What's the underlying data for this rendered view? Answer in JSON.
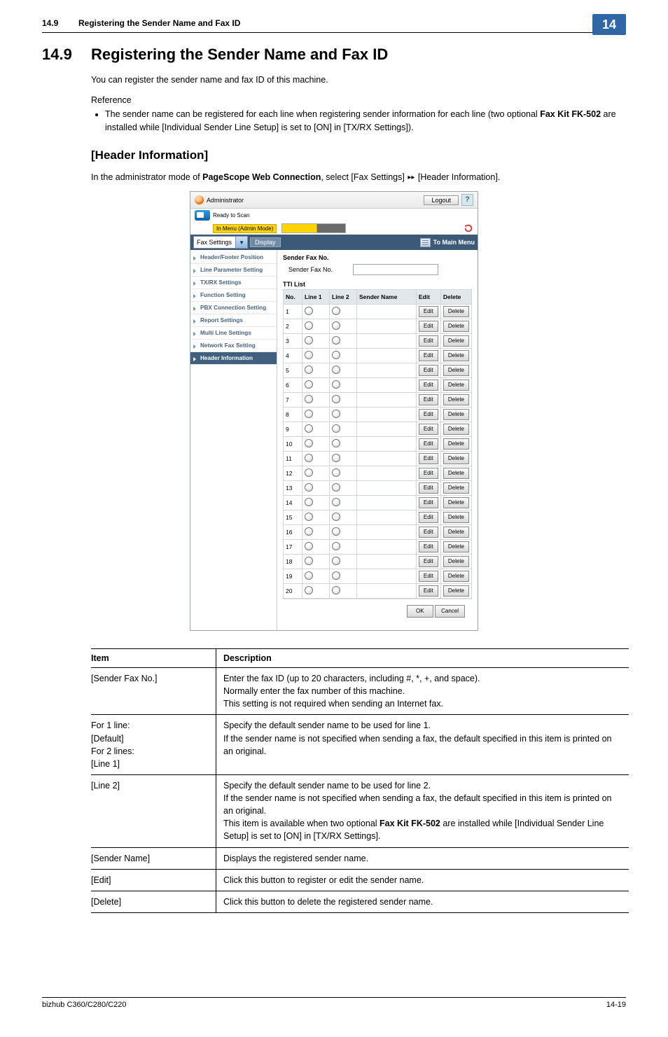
{
  "running_head": {
    "num": "14.9",
    "title": "Registering the Sender Name and Fax ID"
  },
  "chapter_tab": "14",
  "section": {
    "num": "14.9",
    "title": "Registering the Sender Name and Fax ID"
  },
  "intro": "You can register the sender name and fax ID of this machine.",
  "ref_label": "Reference",
  "ref_bullet_parts": {
    "a": "The sender name can be registered for each line when registering sender information for each line (two optional ",
    "b": "Fax Kit FK-502",
    "c": " are installed while [Individual Sender Line Setup] is set to [ON] in [TX/RX Settings])."
  },
  "sub_title": "[Header Information]",
  "sub_intro_parts": {
    "a": "In the administrator mode of ",
    "b": "PageScope Web Connection",
    "c": ", select [Fax Settings] ",
    "d": " [Header Information]."
  },
  "app": {
    "role": "Administrator",
    "logout": "Logout",
    "help": "?",
    "ready": "Ready to Scan",
    "menu_mode": "In Menu (Admin Mode)",
    "nav_select": "Fax Settings",
    "display_btn": "Display",
    "to_main_menu": "To Main Menu",
    "sidebar": [
      {
        "label": "Header/Footer Position",
        "active": false
      },
      {
        "label": "Line Parameter Setting",
        "active": false
      },
      {
        "label": "TX/RX Settings",
        "active": false
      },
      {
        "label": "Function Setting",
        "active": false
      },
      {
        "label": "PBX Connection Setting",
        "active": false
      },
      {
        "label": "Report Settings",
        "active": false
      },
      {
        "label": "Multi Line Settings",
        "active": false
      },
      {
        "label": "Network Fax Setting",
        "active": false
      },
      {
        "label": "Header Information",
        "active": true
      }
    ],
    "sender_fax_no_bold": "Sender Fax No.",
    "sender_fax_no_label": "Sender Fax No.",
    "tti_list_label": "TTI List",
    "tti_headers": {
      "no": "No.",
      "line1": "Line 1",
      "line2": "Line 2",
      "sender": "Sender Name",
      "edit": "Edit",
      "delete": "Delete"
    },
    "row_count": 20,
    "edit_btn": "Edit",
    "delete_btn": "Delete",
    "ok_btn": "OK",
    "cancel_btn": "Cancel"
  },
  "desc_table": {
    "head": {
      "item": "Item",
      "desc": "Description"
    },
    "rows": [
      {
        "item": "[Sender Fax No.]",
        "desc": "Enter the fax ID (up to 20 characters, including #, *, +, and space).\nNormally enter the fax number of this machine.\nThis setting is not required when sending an Internet fax."
      },
      {
        "item": "For 1 line:\n[Default]\nFor 2 lines:\n[Line 1]",
        "desc": "Specify the default sender name to be used for line 1.\nIf the sender name is not specified when sending a fax, the default specified in this item is printed on an original."
      },
      {
        "item": "[Line 2]",
        "desc_parts": {
          "a": "Specify the default sender name to be used for line 2.\nIf the sender name is not specified when sending a fax, the default specified in this item is printed on an original.\nThis item is available when two optional ",
          "b": "Fax Kit FK-502",
          "c": " are installed while [Individual Sender Line Setup] is set to [ON] in [TX/RX Settings]."
        }
      },
      {
        "item": "[Sender Name]",
        "desc": "Displays the registered sender name."
      },
      {
        "item": "[Edit]",
        "desc": "Click this button to register or edit the sender name."
      },
      {
        "item": "[Delete]",
        "desc": "Click this button to delete the registered sender name."
      }
    ]
  },
  "footer": {
    "left": "bizhub C360/C280/C220",
    "right": "14-19"
  }
}
